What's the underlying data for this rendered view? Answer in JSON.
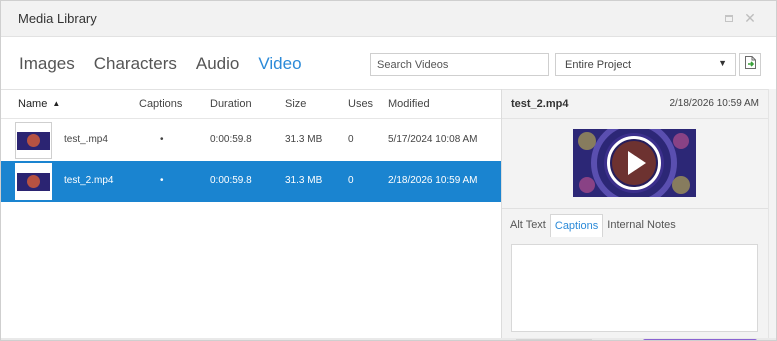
{
  "window": {
    "title": "Media Library"
  },
  "tabs": [
    {
      "label": "Images",
      "active": false
    },
    {
      "label": "Characters",
      "active": false
    },
    {
      "label": "Audio",
      "active": false
    },
    {
      "label": "Video",
      "active": true
    }
  ],
  "search": {
    "placeholder": "Search Videos",
    "value": ""
  },
  "scope": {
    "selected": "Entire Project"
  },
  "icons": {
    "import": "import-file-icon",
    "sort": "sort-ascending-icon",
    "play": "play-icon",
    "maximize": "maximize-icon",
    "close": "close-icon"
  },
  "colors": {
    "accent": "#2b8ad8",
    "selected_row": "#1a84d0"
  },
  "table": {
    "columns": [
      "Name",
      "Captions",
      "Duration",
      "Size",
      "Uses",
      "Modified"
    ],
    "rows": [
      {
        "name": "test_.mp4",
        "captions": "•",
        "duration": "0:00:59.8",
        "size": "31.3 MB",
        "uses": "0",
        "modified": "5/17/2024 10:08 AM",
        "selected": false
      },
      {
        "name": "test_2.mp4",
        "captions": "•",
        "duration": "0:00:59.8",
        "size": "31.3 MB",
        "uses": "0",
        "modified": "2/18/2026 10:59 AM",
        "selected": true
      }
    ]
  },
  "detail": {
    "file_name": "test_2.mp4",
    "date": "2/18/2026 10:59 AM",
    "tabs": [
      {
        "label": "Alt Text",
        "active": false
      },
      {
        "label": "Captions",
        "active": true
      },
      {
        "label": "Internal Notes",
        "active": false
      }
    ],
    "text_value": ""
  }
}
